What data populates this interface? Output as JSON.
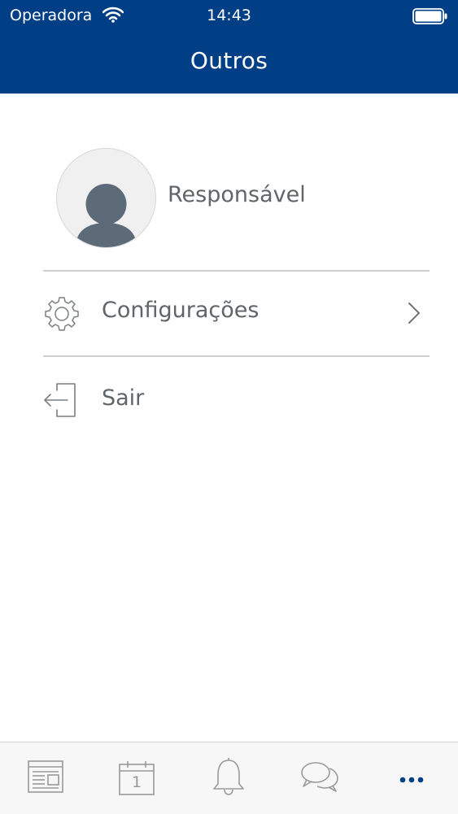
{
  "status_bar": {
    "carrier": "Operadora",
    "time": "14:43",
    "wifi_icon": "wifi-icon",
    "battery_icon": "battery-full-icon"
  },
  "header": {
    "title": "Outros",
    "background_color": "#003f86"
  },
  "profile": {
    "name": "Responsável",
    "avatar_icon": "user-silhouette-icon"
  },
  "menu": [
    {
      "label": "Configurações",
      "icon": "gear-icon",
      "has_chevron": true
    },
    {
      "label": "Sair",
      "icon": "logout-icon",
      "has_chevron": false
    }
  ],
  "tabbar": {
    "tabs": [
      {
        "icon": "news-icon",
        "active": false
      },
      {
        "icon": "calendar-icon",
        "calendar_day": "1",
        "active": false
      },
      {
        "icon": "bell-icon",
        "active": false
      },
      {
        "icon": "chat-icon",
        "active": false
      },
      {
        "icon": "more-icon",
        "active": true
      }
    ],
    "active_color": "#003f86",
    "inactive_color": "#9a9a9a"
  }
}
